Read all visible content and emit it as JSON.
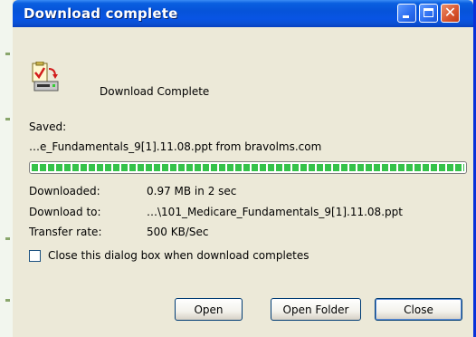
{
  "window": {
    "title": "Download complete"
  },
  "header": {
    "status": "Download Complete"
  },
  "saved": {
    "label": "Saved:",
    "value": "…e_Fundamentals_9[1].11.08.ppt from bravolms.com"
  },
  "progress": {
    "fraction": 1.0
  },
  "details": {
    "downloaded_label": "Downloaded:",
    "downloaded_value": "0.97 MB in 2 sec",
    "download_to_label": "Download to:",
    "download_to_value": "…\\101_Medicare_Fundamentals_9[1].11.08.ppt",
    "transfer_rate_label": "Transfer rate:",
    "transfer_rate_value": "500 KB/Sec"
  },
  "options": {
    "close_when_done_label": "Close this dialog box when download completes",
    "close_when_done_checked": false
  },
  "buttons": {
    "open": "Open",
    "open_folder": "Open Folder",
    "close": "Close"
  },
  "colors": {
    "titlebar": "#0a5fe0",
    "dialog_bg": "#ece9d8",
    "progress_fill": "#35c24a",
    "close_button": "#d8532c"
  }
}
